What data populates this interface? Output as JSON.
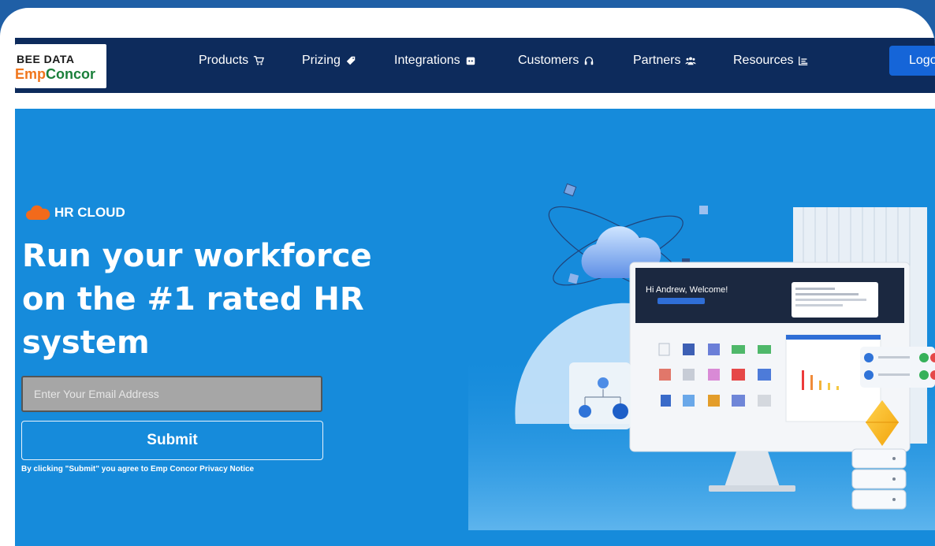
{
  "brand": {
    "line1": "BEE DATA",
    "line2_a": "Emp",
    "line2_b": "Concor"
  },
  "nav": {
    "items": [
      {
        "label": "Products",
        "icon": "cart-icon"
      },
      {
        "label": "Prizing",
        "icon": "tag-icon"
      },
      {
        "label": "Integrations",
        "icon": "puzzle-icon"
      },
      {
        "label": "Customers",
        "icon": "headset-icon"
      },
      {
        "label": "Partners",
        "icon": "users-icon"
      },
      {
        "label": "Resources",
        "icon": "list-icon"
      }
    ],
    "login_label": "Logo"
  },
  "hero": {
    "badge": "HR CLOUD",
    "headline_lines": [
      "Run your workforce",
      "on the #1 rated HR",
      "system"
    ],
    "email_placeholder": "Enter Your Email Address",
    "submit_label": "Submit",
    "privacy_note": "By clicking \"Submit\" you agree to Emp Concor Privacy Notice"
  },
  "illustration": {
    "welcome_text": "Hi Andrew, Welcome!"
  },
  "colors": {
    "navbar": "#0d2b5c",
    "hero": "#168bdb",
    "login_button": "#1565d8",
    "logo_orange": "#f0761c",
    "logo_green": "#1a7f3a",
    "cloud_orange": "#f26a1b"
  }
}
